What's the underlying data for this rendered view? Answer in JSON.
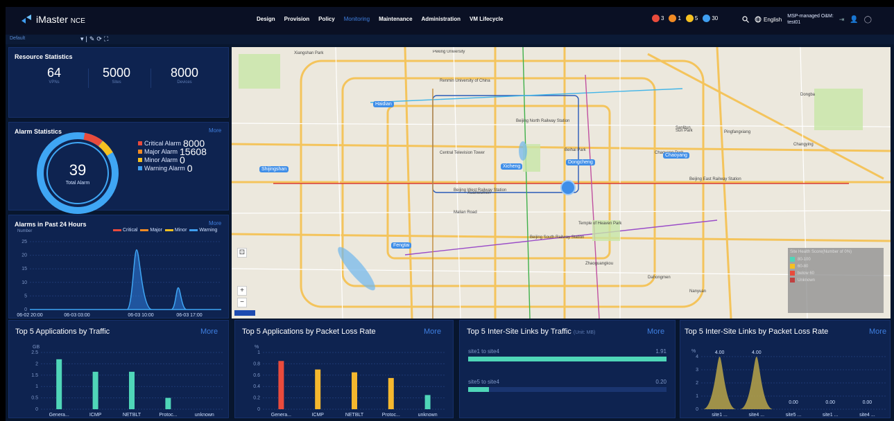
{
  "app": {
    "name": "iMaster",
    "suffix": "NCE"
  },
  "nav": [
    "Design",
    "Provision",
    "Policy",
    "Monitoring",
    "Maintenance",
    "Administration",
    "VM Lifecycle"
  ],
  "nav_active": "Monitoring",
  "alarm_badges": [
    {
      "count": "3",
      "color": "#e94b3c",
      "icon": "critical-alarm-icon"
    },
    {
      "count": "1",
      "color": "#f08a24",
      "icon": "major-alarm-icon"
    },
    {
      "count": "5",
      "color": "#f5c021",
      "icon": "minor-alarm-icon"
    },
    {
      "count": "30",
      "color": "#3f9ef0",
      "icon": "warning-alarm-icon"
    }
  ],
  "language": "English",
  "tenant": {
    "line1": "MSP-managed O&M:",
    "line2": "test01"
  },
  "subbar": {
    "view": "Default"
  },
  "resource": {
    "title": "Resource Statistics",
    "items": [
      {
        "value": "64",
        "label": "VPNs"
      },
      {
        "value": "5000",
        "label": "Sites"
      },
      {
        "value": "8000",
        "label": "Devices"
      }
    ]
  },
  "alarm_stats": {
    "title": "Alarm Statistics",
    "more": "More",
    "total": "39",
    "total_label": "Total Alarm",
    "legend": [
      {
        "label": "Critical Alarm",
        "value": "8000",
        "color": "#e94b3c"
      },
      {
        "label": "Major Alarm",
        "value": "15608",
        "color": "#f08a24"
      },
      {
        "label": "Minor Alarm",
        "value": "0",
        "color": "#f5c021"
      },
      {
        "label": "Warning Alarm",
        "value": "0",
        "color": "#3f9ef0"
      }
    ]
  },
  "alarms24": {
    "title": "Alarms in Past 24 Hours",
    "more": "More",
    "ylabel": "Number",
    "legend": [
      {
        "label": "Critical",
        "color": "#e94b3c"
      },
      {
        "label": "Major",
        "color": "#f08a24"
      },
      {
        "label": "Minor",
        "color": "#f5c021"
      },
      {
        "label": "Warning",
        "color": "#3f9ef0"
      }
    ],
    "yticks": [
      "25",
      "20",
      "15",
      "10",
      "5",
      "0"
    ],
    "xticks": [
      "06-02 20:00",
      "06-03 03:00",
      "06-03 10:00",
      "06-03 17:00"
    ]
  },
  "map": {
    "labels": [
      "Xiangshan Park",
      "Peking University",
      "Renmin University of China",
      "Beijing North Railway Station",
      "Beijing West Railway Station",
      "Beijing South Railway Station",
      "Beijing East Railway Station",
      "Central Television Tower",
      "Temple of Heaven Park",
      "Malian Road",
      "Xuanwumen",
      "Sanlitun",
      "Dongba",
      "Pingfangxiang",
      "Changying",
      "Dahongmen",
      "Nanyuan",
      "Zhaoguangkou",
      "Sun Park",
      "Beihai Park",
      "Chaoyang Park"
    ],
    "districts": [
      "Haidian",
      "Xicheng",
      "Dongcheng",
      "Shijingshan",
      "Chaoyang",
      "Fengtai"
    ],
    "health_title": "Site Health Score(Number of 0%)",
    "health_rows": [
      "80-100",
      "60-80",
      "below 60",
      "Unknown"
    ]
  },
  "apps_traffic": {
    "title": "Top 5 Applications by Traffic",
    "more": "More"
  },
  "apps_loss": {
    "title": "Top 5 Applications by Packet Loss Rate",
    "more": "More"
  },
  "links_traffic": {
    "title": "Top 5 Inter-Site Links by Traffic",
    "unit": "(Unit: MB)",
    "more": "More",
    "rows": [
      {
        "label": "site1 to site4",
        "value": "1.91",
        "fraction": 1.0
      },
      {
        "label": "site5 to site4",
        "value": "0.20",
        "fraction": 0.105
      }
    ]
  },
  "links_loss": {
    "title": "Top 5 Inter-Site Links by Packet Loss Rate",
    "more": "More"
  },
  "chart_data": [
    {
      "type": "area",
      "title": "Alarms in Past 24 Hours",
      "ylabel": "Number",
      "ylim": [
        0,
        25
      ],
      "x": [
        "06-02 20:00",
        "06-03 03:00",
        "06-03 10:00",
        "06-03 17:00"
      ],
      "series": [
        {
          "name": "Warning",
          "peaks": [
            {
              "x": "06-03 09:00",
              "y": 22
            },
            {
              "x": "06-03 13:00",
              "y": 8
            }
          ]
        }
      ]
    },
    {
      "type": "bar",
      "title": "Top 5 Applications by Traffic",
      "ylabel": "GB",
      "ylim": [
        0,
        2.5
      ],
      "yticks": [
        "2.5",
        "2",
        "1.5",
        "1",
        "0.5",
        "0"
      ],
      "categories": [
        "Genera...",
        "ICMP",
        "NETBLT",
        "Protoc...",
        "unknown"
      ],
      "values": [
        2.2,
        1.65,
        1.65,
        0.5,
        0
      ],
      "colors": [
        "#4fd6b8",
        "#4fd6b8",
        "#4fd6b8",
        "#4fd6b8",
        "#4fd6b8"
      ]
    },
    {
      "type": "bar",
      "title": "Top 5 Applications by Packet Loss Rate",
      "ylabel": "%",
      "ylim": [
        0,
        1
      ],
      "yticks": [
        "1",
        "0.8",
        "0.6",
        "0.4",
        "0.2",
        "0"
      ],
      "categories": [
        "Genera...",
        "ICMP",
        "NETBLT",
        "Protoc...",
        "unknown"
      ],
      "values": [
        0.85,
        0.7,
        0.65,
        0.55,
        0.25
      ],
      "colors": [
        "#e94b3c",
        "#f5b82e",
        "#f5b82e",
        "#f5b82e",
        "#4fd6b8"
      ]
    },
    {
      "type": "area",
      "title": "Top 5 Inter-Site Links by Packet Loss Rate",
      "ylabel": "%",
      "ylim": [
        0,
        4
      ],
      "yticks": [
        "4",
        "3",
        "2",
        "1",
        "0"
      ],
      "categories": [
        "site1 ...",
        "site4 ...",
        "site5 ...",
        "site1 ...",
        "site4 ..."
      ],
      "values": [
        4.0,
        4.0,
        0.0,
        0.0,
        0.0
      ],
      "labels": [
        "4.00",
        "4.00",
        "0.00",
        "0.00",
        "0.00"
      ]
    }
  ]
}
